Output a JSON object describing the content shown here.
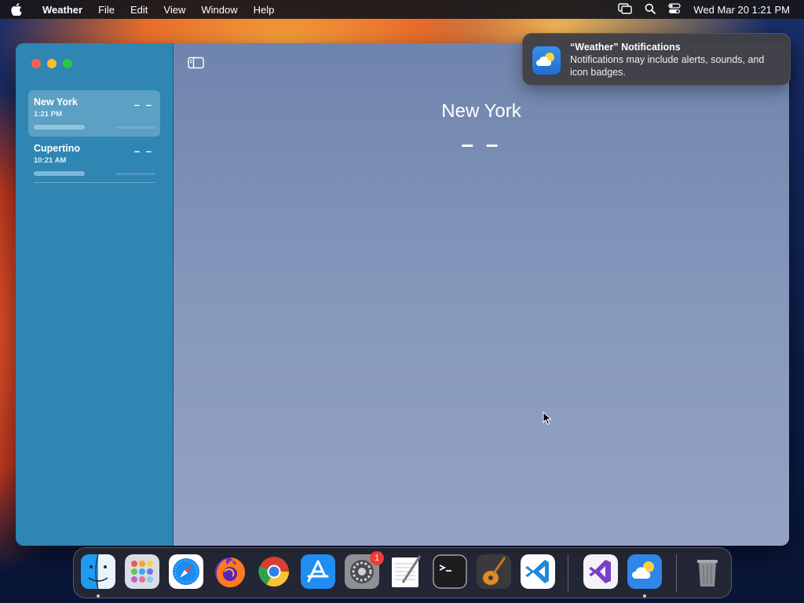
{
  "menubar": {
    "app_name": "Weather",
    "items": [
      "File",
      "Edit",
      "View",
      "Window",
      "Help"
    ],
    "clock": "Wed Mar 20  1:21 PM",
    "icons": [
      "apple-icon",
      "screen-mirroring-icon",
      "spotlight-search-icon",
      "control-center-icon"
    ]
  },
  "sidebar": {
    "locations": [
      {
        "name": "New York",
        "time": "1:21 PM",
        "temp": "– –",
        "selected": true
      },
      {
        "name": "Cupertino",
        "time": "10:21 AM",
        "temp": "– –",
        "selected": false
      }
    ]
  },
  "main": {
    "city": "New York",
    "temp": "– –"
  },
  "notification": {
    "title": "“Weather” Notifications",
    "body": "Notifications may include alerts, sounds, and icon badges."
  },
  "dock": {
    "apps": [
      "Finder",
      "Launchpad",
      "Safari",
      "Firefox",
      "Google Chrome",
      "App Store",
      "System Settings",
      "TextEdit",
      "Terminal",
      "GarageBand",
      "Visual Studio Code",
      "Visual Studio",
      "Weather",
      "Trash"
    ],
    "system_settings_badge": "1"
  },
  "colors": {
    "sidebar": "#2f86b3",
    "main_top": "#6f84ad",
    "main_bottom": "#93a3c6",
    "notification_bg": "#404046",
    "close": "#fe5f57",
    "minimize": "#febc2e",
    "maximize": "#28c840"
  }
}
